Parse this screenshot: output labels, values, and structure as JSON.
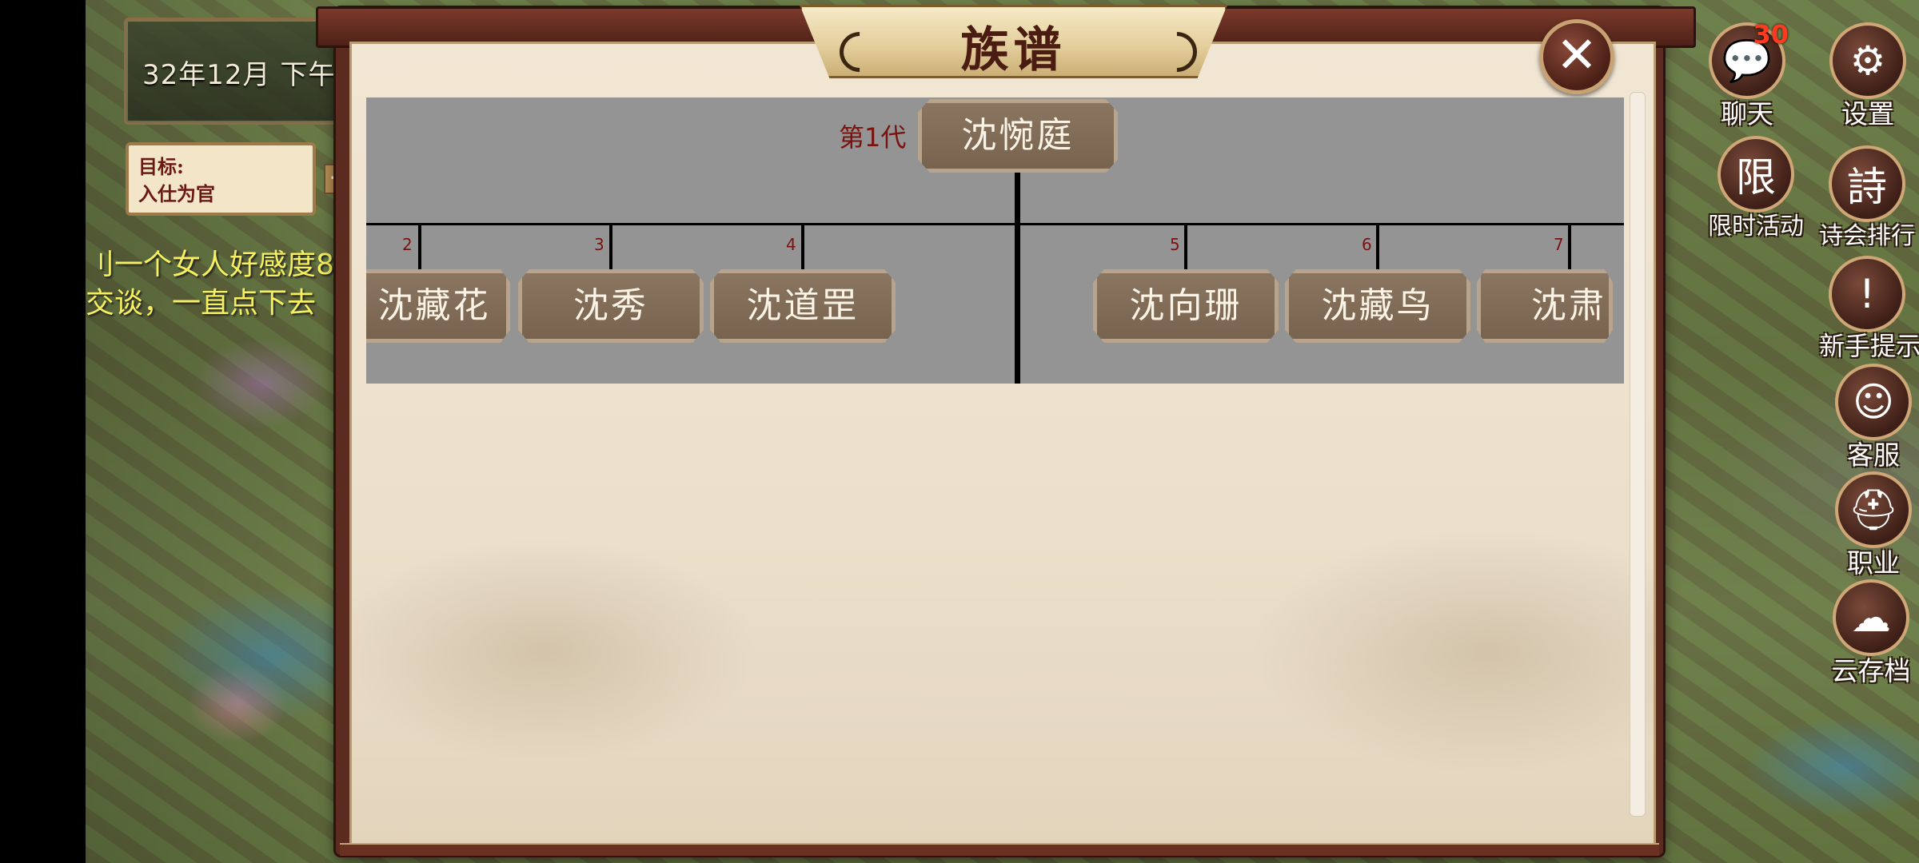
{
  "hud": {
    "date": "32年12月  下午",
    "goal_line1": "目标:",
    "goal_line2": "入仕为官",
    "goal_plus": "+",
    "hint_line1": "刂一个女人好感度8",
    "hint_line2": "交谈，一直点下去"
  },
  "side_buttons": [
    {
      "id": "chat",
      "label": "聊天",
      "icon": "chat-bubble-icon",
      "glyph": "💬",
      "badge": "30"
    },
    {
      "id": "settings",
      "label": "设置",
      "icon": "gear-icon",
      "glyph": "⚙"
    },
    {
      "id": "limited-event",
      "label": "限时活动",
      "icon": "limited-icon",
      "glyph": "限"
    },
    {
      "id": "poetry-rank",
      "label": "诗会排行",
      "icon": "poem-icon",
      "glyph": "詩"
    },
    {
      "id": "newbie-tips",
      "label": "新手提示",
      "icon": "exclamation-scroll-icon",
      "glyph": "!"
    },
    {
      "id": "customer-service",
      "label": "客服",
      "icon": "headset-person-icon",
      "glyph": "☺"
    },
    {
      "id": "career",
      "label": "职业",
      "icon": "helmet-icon",
      "glyph": "⛑"
    },
    {
      "id": "cloud-save",
      "label": "云存档",
      "icon": "cloud-upload-icon",
      "glyph": "☁"
    }
  ],
  "dialog": {
    "title": "族谱",
    "close_glyph": "✕"
  },
  "tree": {
    "generation_label": "第1代",
    "root_name": "沈惋庭",
    "children": [
      {
        "num": "2",
        "name": "沈藏花"
      },
      {
        "num": "3",
        "name": "沈秀"
      },
      {
        "num": "4",
        "name": "沈道罡"
      },
      {
        "num": "5",
        "name": "沈向珊"
      },
      {
        "num": "6",
        "name": "沈藏鸟"
      },
      {
        "num": "7",
        "name": "沈肃"
      }
    ]
  }
}
